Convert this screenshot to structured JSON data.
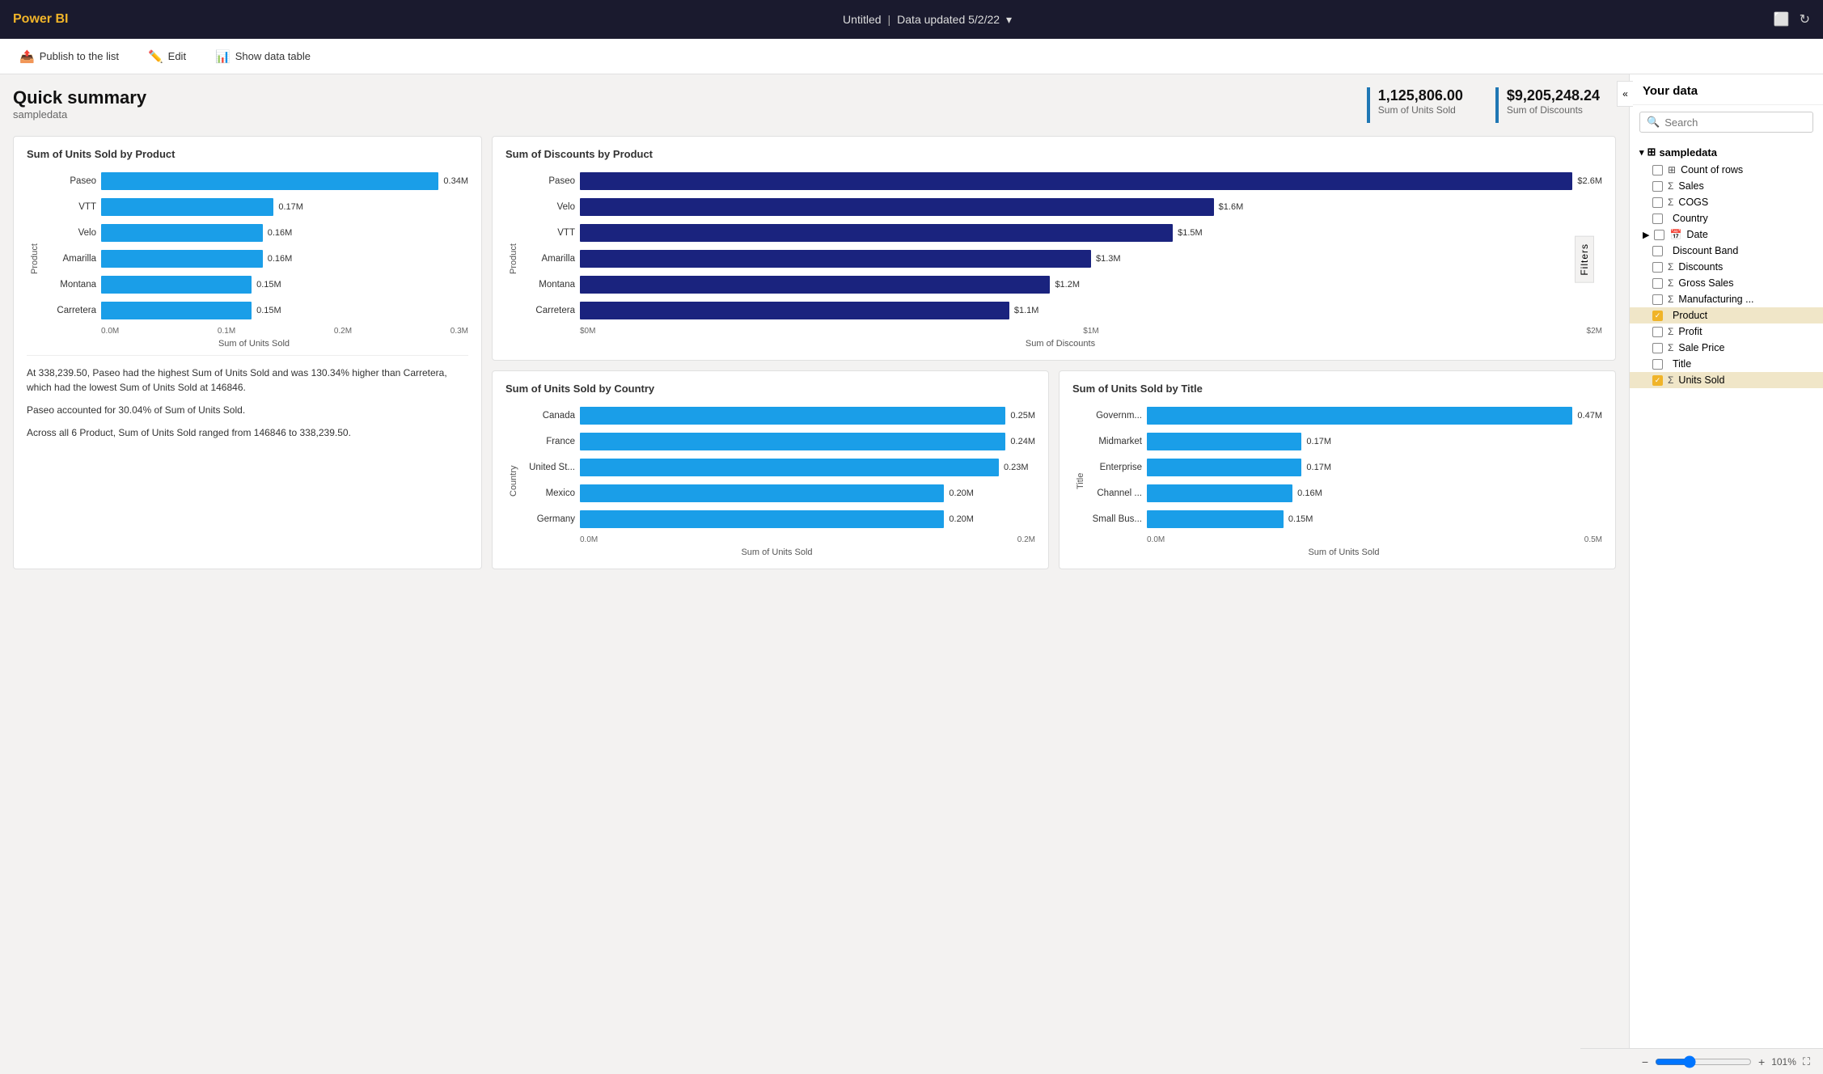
{
  "topbar": {
    "logo": "Power BI",
    "title": "Untitled",
    "data_updated": "Data updated 5/2/22",
    "chevron": "▾"
  },
  "toolbar": {
    "publish_label": "Publish to the list",
    "edit_label": "Edit",
    "show_data_label": "Show data table"
  },
  "page": {
    "title": "Quick summary",
    "subtitle": "sampledata"
  },
  "kpis": [
    {
      "value": "1,125,806.00",
      "label": "Sum of Units Sold"
    },
    {
      "value": "$9,205,248.24",
      "label": "Sum of Discounts"
    }
  ],
  "charts": {
    "units_by_product": {
      "title": "Sum of Units Sold by Product",
      "y_axis": "Product",
      "x_axis": "Sum of Units Sold",
      "x_ticks": [
        "0.0M",
        "0.1M",
        "0.2M",
        "0.3M"
      ],
      "bars": [
        {
          "label": "Paseo",
          "value": "0.34M",
          "pct": 95
        },
        {
          "label": "VTT",
          "value": "0.17M",
          "pct": 47
        },
        {
          "label": "Velo",
          "value": "0.16M",
          "pct": 44
        },
        {
          "label": "Amarilla",
          "value": "0.16M",
          "pct": 44
        },
        {
          "label": "Montana",
          "value": "0.15M",
          "pct": 41
        },
        {
          "label": "Carretera",
          "value": "0.15M",
          "pct": 41
        }
      ],
      "color": "#1a9ee8",
      "insights": [
        "At 338,239.50, Paseo had the highest Sum of Units Sold and was 130.34% higher than Carretera, which had the lowest Sum of Units Sold at 146846.",
        "Paseo accounted for 30.04% of Sum of Units Sold.",
        "Across all 6 Product, Sum of Units Sold ranged from 146846 to 338,239.50."
      ]
    },
    "discounts_by_product": {
      "title": "Sum of Discounts by Product",
      "y_axis": "Product",
      "x_axis": "Sum of Discounts",
      "x_ticks": [
        "$0M",
        "$1M",
        "$2M"
      ],
      "bars": [
        {
          "label": "Paseo",
          "value": "$2.6M",
          "pct": 100
        },
        {
          "label": "Velo",
          "value": "$1.6M",
          "pct": 62
        },
        {
          "label": "VTT",
          "value": "$1.5M",
          "pct": 58
        },
        {
          "label": "Amarilla",
          "value": "$1.3M",
          "pct": 50
        },
        {
          "label": "Montana",
          "value": "$1.2M",
          "pct": 46
        },
        {
          "label": "Carretera",
          "value": "$1.1M",
          "pct": 42
        }
      ],
      "color": "#1a237e"
    },
    "units_by_country": {
      "title": "Sum of Units Sold by Country",
      "y_axis": "Country",
      "x_axis": "Sum of Units Sold",
      "x_ticks": [
        "0.0M",
        "0.2M"
      ],
      "bars": [
        {
          "label": "Canada",
          "value": "0.25M",
          "pct": 100
        },
        {
          "label": "France",
          "value": "0.24M",
          "pct": 96
        },
        {
          "label": "United St...",
          "value": "0.23M",
          "pct": 92
        },
        {
          "label": "Mexico",
          "value": "0.20M",
          "pct": 80
        },
        {
          "label": "Germany",
          "value": "0.20M",
          "pct": 80
        }
      ],
      "color": "#1a9ee8"
    },
    "units_by_title": {
      "title": "Sum of Units Sold by Title",
      "y_axis": "Title",
      "x_axis": "Sum of Units Sold",
      "x_ticks": [
        "0.0M",
        "0.5M"
      ],
      "bars": [
        {
          "label": "Governm...",
          "value": "0.47M",
          "pct": 100
        },
        {
          "label": "Midmarket",
          "value": "0.17M",
          "pct": 36
        },
        {
          "label": "Enterprise",
          "value": "0.17M",
          "pct": 36
        },
        {
          "label": "Channel ...",
          "value": "0.16M",
          "pct": 34
        },
        {
          "label": "Small Bus...",
          "value": "0.15M",
          "pct": 32
        }
      ],
      "color": "#1a9ee8"
    }
  },
  "right_panel": {
    "title": "Your data",
    "search_placeholder": "Search",
    "dataset": "sampledata",
    "items": [
      {
        "name": "Count of rows",
        "type": "table",
        "checked": false
      },
      {
        "name": "Sales",
        "type": "sigma",
        "checked": false
      },
      {
        "name": "COGS",
        "type": "sigma",
        "checked": false
      },
      {
        "name": "Country",
        "type": "text",
        "checked": false
      },
      {
        "name": "Date",
        "type": "calendar",
        "checked": false,
        "expandable": true
      },
      {
        "name": "Discount Band",
        "type": "text",
        "checked": false
      },
      {
        "name": "Discounts",
        "type": "sigma",
        "checked": false
      },
      {
        "name": "Gross Sales",
        "type": "sigma",
        "checked": false
      },
      {
        "name": "Manufacturing ...",
        "type": "sigma",
        "checked": false
      },
      {
        "name": "Product",
        "type": "text",
        "checked": true,
        "selected": true
      },
      {
        "name": "Profit",
        "type": "sigma",
        "checked": false
      },
      {
        "name": "Sale Price",
        "type": "sigma",
        "checked": false
      },
      {
        "name": "Title",
        "type": "text",
        "checked": false
      },
      {
        "name": "Units Sold",
        "type": "sigma",
        "checked": true,
        "selected": true
      }
    ]
  },
  "filters_tab": "Filters",
  "zoom": "101%"
}
